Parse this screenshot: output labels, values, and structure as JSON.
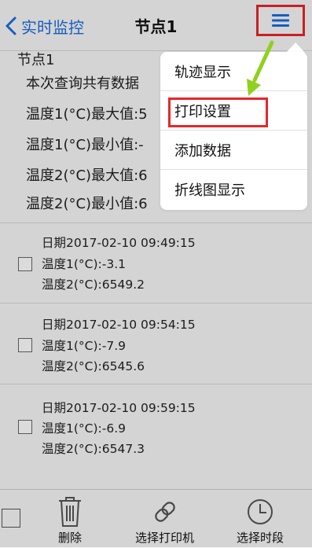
{
  "nav": {
    "back_label": "实时监控",
    "title": "节点1"
  },
  "summary": {
    "node_label": "节点1",
    "lines": [
      "本次查询共有数据",
      "温度1(°C)最大值:5",
      "温度1(°C)最小值:-",
      "温度2(°C)最大值:6",
      "温度2(°C)最小值:6"
    ]
  },
  "records": [
    {
      "date": "日期2017-02-10 09:49:15",
      "t1": "温度1(°C):-3.1",
      "t2": "温度2(°C):6549.2"
    },
    {
      "date": "日期2017-02-10 09:54:15",
      "t1": "温度1(°C):-7.9",
      "t2": "温度2(°C):6545.6"
    },
    {
      "date": "日期2017-02-10 09:59:15",
      "t1": "温度1(°C):-6.9",
      "t2": "温度2(°C):6547.3"
    }
  ],
  "toolbar": {
    "delete_label": "删除",
    "printer_label": "选择打印机",
    "time_label": "选择时段"
  },
  "menu": {
    "items": [
      "轨迹显示",
      "打印设置",
      "添加数据",
      "折线图显示"
    ]
  },
  "colors": {
    "accent": "#1a6ee0",
    "highlight": "#e8262b",
    "arrow": "#8fd11f"
  }
}
